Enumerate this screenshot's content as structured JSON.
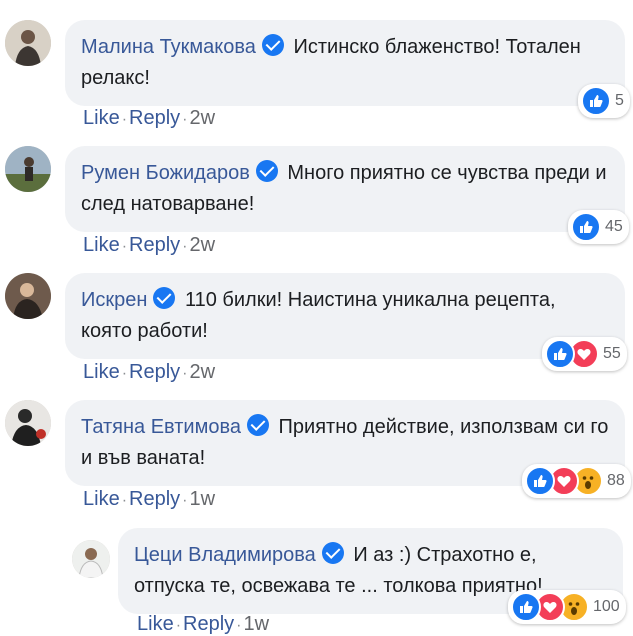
{
  "comments": [
    {
      "name": "Малина Тукмакова",
      "text": "Истинско блаженство! Тотален релакс!",
      "actions": {
        "like": "Like",
        "reply": "Reply",
        "time": "2w"
      },
      "reactions": {
        "types": [
          "like"
        ],
        "count": "5"
      }
    },
    {
      "name": "Румен Божидаров",
      "text": "Много приятно се чувства преди и след натоварване!",
      "actions": {
        "like": "Like",
        "reply": "Reply",
        "time": "2w"
      },
      "reactions": {
        "types": [
          "like"
        ],
        "count": "45"
      }
    },
    {
      "name": "Искрен",
      "text": "110 билки! Наистина уникална рецепта, която работи!",
      "actions": {
        "like": "Like",
        "reply": "Reply",
        "time": "2w"
      },
      "reactions": {
        "types": [
          "like",
          "love"
        ],
        "count": "55"
      }
    },
    {
      "name": "Татяна Евтимова",
      "text": "Приятно действие, използвам си го и във ваната!",
      "actions": {
        "like": "Like",
        "reply": "Reply",
        "time": "1w"
      },
      "reactions": {
        "types": [
          "like",
          "love",
          "wow"
        ],
        "count": "88"
      }
    },
    {
      "name": "Цеци Владимирова",
      "text": "И аз :) Страхотно е, отпуска те, освежава те ... толкова приятно!",
      "actions": {
        "like": "Like",
        "reply": "Reply",
        "time": "1w"
      },
      "reactions": {
        "types": [
          "like",
          "love",
          "wow"
        ],
        "count": "100"
      }
    }
  ],
  "colors": {
    "name": "#385898",
    "bubble": "#f0f2f5",
    "like": "#1877f2",
    "love": "#f33e58",
    "wow": "#f7b125"
  }
}
